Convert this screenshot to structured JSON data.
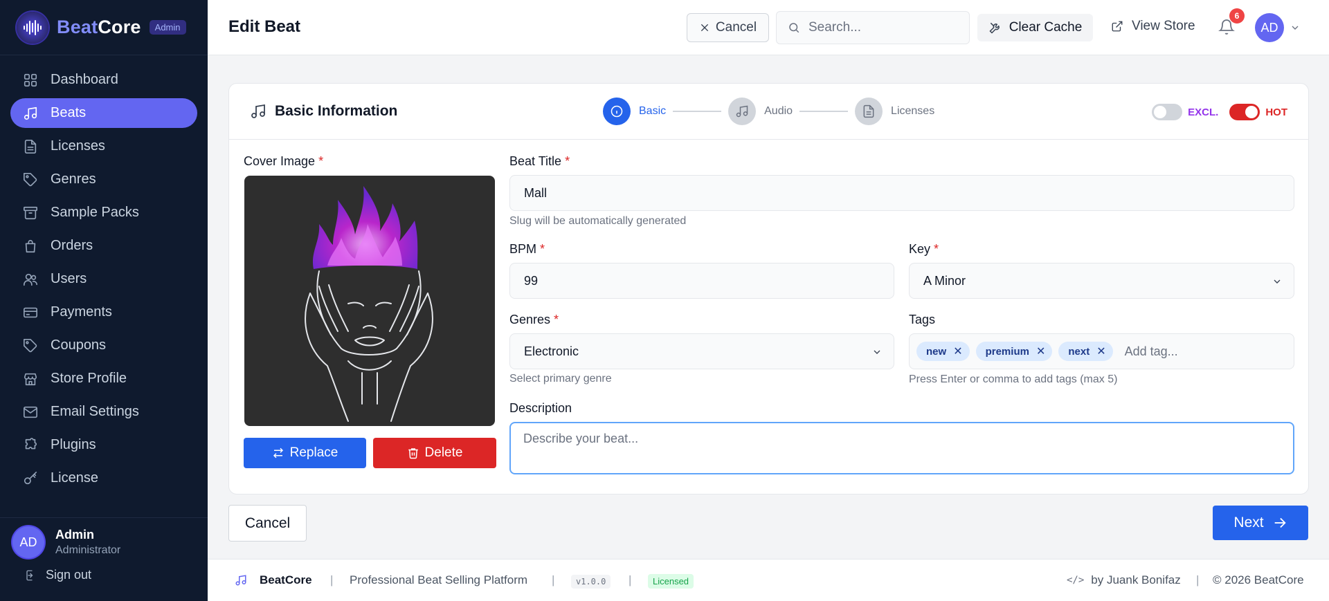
{
  "brand": {
    "name_part1": "Beat",
    "name_part2": "Core",
    "badge": "Admin"
  },
  "sidebar": {
    "items": [
      {
        "label": "Dashboard",
        "icon": "dashboard-icon"
      },
      {
        "label": "Beats",
        "icon": "music-note-icon",
        "active": true
      },
      {
        "label": "Licenses",
        "icon": "document-icon"
      },
      {
        "label": "Genres",
        "icon": "tag-icon"
      },
      {
        "label": "Sample Packs",
        "icon": "archive-icon"
      },
      {
        "label": "Orders",
        "icon": "shopping-bag-icon"
      },
      {
        "label": "Users",
        "icon": "users-icon"
      },
      {
        "label": "Payments",
        "icon": "credit-card-icon"
      },
      {
        "label": "Coupons",
        "icon": "coupon-tag-icon"
      },
      {
        "label": "Store Profile",
        "icon": "store-icon"
      },
      {
        "label": "Email Settings",
        "icon": "mail-icon"
      },
      {
        "label": "Plugins",
        "icon": "puzzle-icon"
      },
      {
        "label": "License",
        "icon": "key-icon"
      }
    ],
    "user": {
      "initials": "AD",
      "name": "Admin",
      "role": "Administrator"
    },
    "signout_label": "Sign out"
  },
  "header": {
    "title": "Edit Beat",
    "cancel_label": "Cancel",
    "search_placeholder": "Search...",
    "clear_cache_label": "Clear Cache",
    "view_store_label": "View Store",
    "notification_count": "6",
    "avatar_initials": "AD"
  },
  "card": {
    "title": "Basic Information",
    "steps": [
      {
        "label": "Basic",
        "active": true
      },
      {
        "label": "Audio",
        "active": false
      },
      {
        "label": "Licenses",
        "active": false
      }
    ],
    "toggles": {
      "excl_label": "EXCL.",
      "excl_on": false,
      "hot_label": "HOT",
      "hot_on": true
    }
  },
  "form": {
    "cover_label": "Cover Image",
    "replace_label": "Replace",
    "delete_label": "Delete",
    "title_label": "Beat Title",
    "title_value": "Mall",
    "slug_hint": "Slug will be automatically generated",
    "bpm_label": "BPM",
    "bpm_value": "99",
    "key_label": "Key",
    "key_value": "A Minor",
    "genres_label": "Genres",
    "genres_value": "Electronic",
    "genres_hint": "Select primary genre",
    "tags_label": "Tags",
    "tags": [
      "new",
      "premium",
      "next"
    ],
    "tag_placeholder": "Add tag...",
    "tags_hint": "Press Enter or comma to add tags (max 5)",
    "description_label": "Description",
    "description_placeholder": "Describe your beat...",
    "required_marker": "*"
  },
  "actions": {
    "cancel_label": "Cancel",
    "next_label": "Next"
  },
  "footer": {
    "brand": "BeatCore",
    "tagline": "Professional Beat Selling Platform",
    "version": "v1.0.0",
    "status": "Licensed",
    "credit": "by Juank Bonifaz",
    "copyright": "© 2026 BeatCore"
  },
  "colors": {
    "accent": "#6366f1",
    "primary": "#2563eb",
    "danger": "#dc2626",
    "sidebar_bg": "#0f1a2e"
  }
}
